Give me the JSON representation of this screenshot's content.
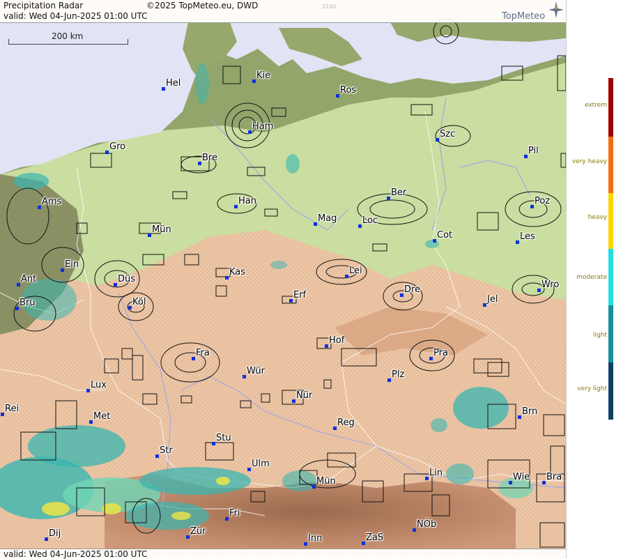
{
  "header": {
    "title": "Precipitation Radar",
    "copyright": "©2025 TopMeteo.eu, DWD",
    "code": "3100",
    "valid": "valid:  Wed  04-Jun-2025 01:00 UTC",
    "logo": "TopMeteo"
  },
  "scale": {
    "label": "200 km"
  },
  "footer": {
    "valid": "valid:  Wed  04-Jun-2025 01:00 UTC"
  },
  "cities": [
    {
      "label": "Hel"
    },
    {
      "label": "Kie"
    },
    {
      "label": "Ros"
    },
    {
      "label": "Ham"
    },
    {
      "label": "Szc"
    },
    {
      "label": "Gro"
    },
    {
      "label": "Bre"
    },
    {
      "label": "Pil"
    },
    {
      "label": "Ams"
    },
    {
      "label": "Han"
    },
    {
      "label": "Ber"
    },
    {
      "label": "Poz"
    },
    {
      "label": "Mün"
    },
    {
      "label": "Mag"
    },
    {
      "label": "Loc"
    },
    {
      "label": "Cot"
    },
    {
      "label": "Les"
    },
    {
      "label": "Ein"
    },
    {
      "label": "Kas"
    },
    {
      "label": "Lei"
    },
    {
      "label": "Ant"
    },
    {
      "label": "Düs"
    },
    {
      "label": "Dre"
    },
    {
      "label": "Wro"
    },
    {
      "label": "Bru"
    },
    {
      "label": "Köl"
    },
    {
      "label": "Erf"
    },
    {
      "label": "Jel"
    },
    {
      "label": "Hof"
    },
    {
      "label": "Fra"
    },
    {
      "label": "Pra"
    },
    {
      "label": "Wür"
    },
    {
      "label": "Plz"
    },
    {
      "label": "Lux"
    },
    {
      "label": "Nür"
    },
    {
      "label": "Rei"
    },
    {
      "label": "Met"
    },
    {
      "label": "Reg"
    },
    {
      "label": "Brn"
    },
    {
      "label": "Stu"
    },
    {
      "label": "Str"
    },
    {
      "label": "Ulm"
    },
    {
      "label": "Mün"
    },
    {
      "label": "Lin"
    },
    {
      "label": "Wie"
    },
    {
      "label": "Bra"
    },
    {
      "label": "Fri"
    },
    {
      "label": "Dij"
    },
    {
      "label": "Zür"
    },
    {
      "label": "NÖb"
    },
    {
      "label": "Inn"
    },
    {
      "label": "ZaS"
    }
  ],
  "legend": [
    {
      "label": "extrem",
      "color": "#a00000"
    },
    {
      "label": "very heavy",
      "color": "#f07010"
    },
    {
      "label": "heavy",
      "color": "#ffd700"
    },
    {
      "label": "moderate",
      "color": "#20e0e0"
    },
    {
      "label": "light",
      "color": "#1a8fa0"
    },
    {
      "label": "very light",
      "color": "#0f4060"
    }
  ],
  "colors": {
    "sea": "#e2e3f4",
    "lowland": "#8fa86a",
    "plain": "#c8df9f",
    "upland": "#f2c9a8",
    "mountain": "#b47d5c",
    "radar_light": "#3ab6b0",
    "radar_moderate": "#6fd6b6",
    "radar_heavy": "#e6e24a",
    "city_marker": "#1030e0"
  }
}
